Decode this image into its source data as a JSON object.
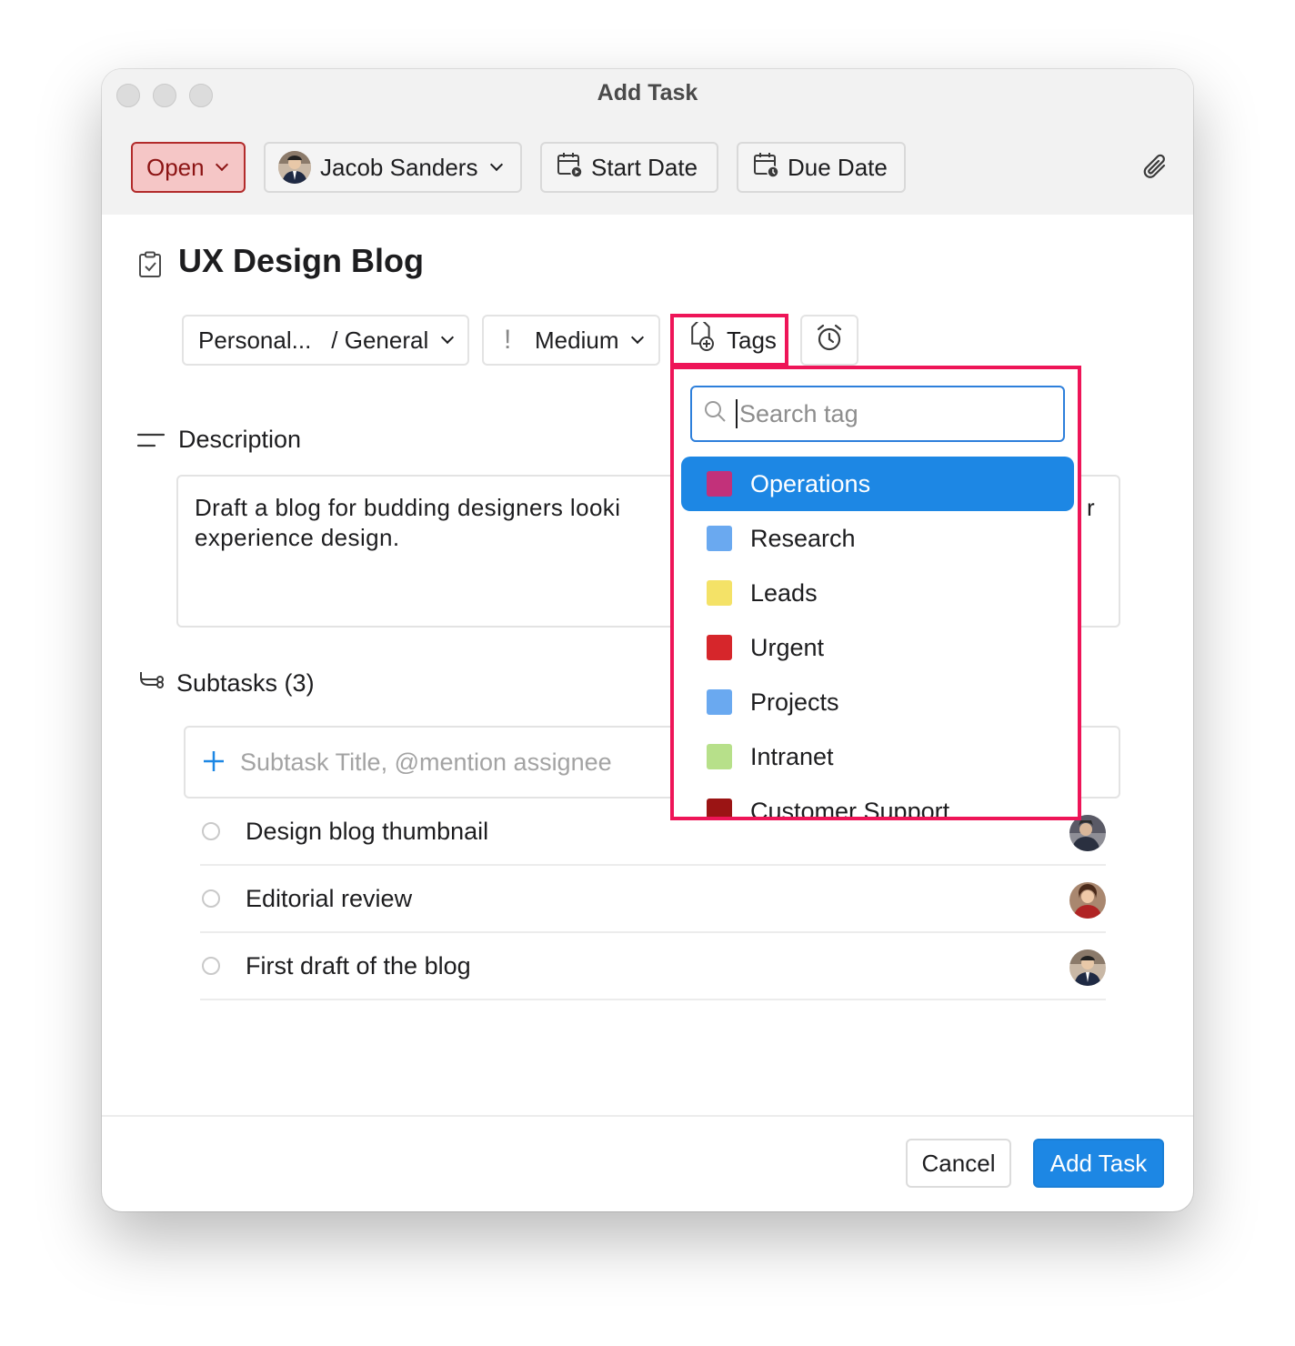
{
  "window": {
    "title": "Add Task"
  },
  "toolbar": {
    "status": "Open",
    "assignee": "Jacob Sanders",
    "start_date": "Start Date",
    "due_date": "Due Date"
  },
  "task": {
    "title": "UX Design Blog",
    "project": "Personal...",
    "section": "/ General",
    "priority": "Medium",
    "priority_mark": "!",
    "tags_label": "Tags"
  },
  "description": {
    "label": "Description",
    "text": "Draft a blog for budding designers looki",
    "text_line2": "experience design.",
    "overflow_char": "r"
  },
  "subtasks": {
    "label": "Subtasks (3)",
    "input_placeholder": "Subtask Title, @mention assignee",
    "items": [
      {
        "title": "Design blog thumbnail"
      },
      {
        "title": "Editorial review"
      },
      {
        "title": "First draft of the blog"
      }
    ]
  },
  "tags_dropdown": {
    "search_placeholder": "Search tag",
    "items": [
      {
        "label": "Operations",
        "color": "#c2317a",
        "selected": true
      },
      {
        "label": "Research",
        "color": "#6aa9f0"
      },
      {
        "label": "Leads",
        "color": "#f4e267"
      },
      {
        "label": "Urgent",
        "color": "#d6262b"
      },
      {
        "label": "Projects",
        "color": "#6aa9f0"
      },
      {
        "label": "Intranet",
        "color": "#b7e08a"
      },
      {
        "label": "Customer Support",
        "color": "#9b1414"
      }
    ]
  },
  "footer": {
    "cancel": "Cancel",
    "submit": "Add Task"
  },
  "colors": {
    "accent": "#1d87e4",
    "highlight": "#ee1558",
    "status_bg": "#f5c6c6",
    "status_text": "#8c1414"
  }
}
